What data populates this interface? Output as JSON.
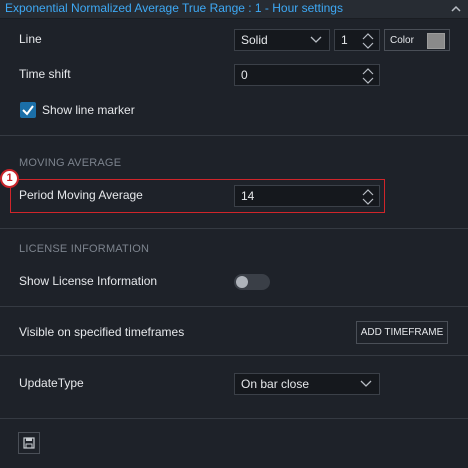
{
  "window": {
    "title": "Exponential Normalized Average True Range : 1 - Hour settings"
  },
  "line": {
    "label": "Line",
    "style_value": "Solid",
    "width_value": "1",
    "color_button_label": "Color",
    "color_swatch": "#8a8a8a"
  },
  "time_shift": {
    "label": "Time shift",
    "value": "0"
  },
  "show_line_marker": {
    "label": "Show line marker",
    "checked": true
  },
  "moving_average": {
    "section_title": "MOVING AVERAGE",
    "period_label": "Period Moving Average",
    "period_value": "14",
    "callout_number": "1"
  },
  "license": {
    "section_title": "LICENSE INFORMATION",
    "show_label": "Show License Information",
    "enabled": false
  },
  "timeframes": {
    "label": "Visible on specified timeframes",
    "button_label": "ADD TIMEFRAME"
  },
  "update_type": {
    "label": "UpdateType",
    "value": "On bar close"
  },
  "footer": {
    "save_icon": "save-icon"
  },
  "colors": {
    "accent": "#3ea9f5",
    "checkbox": "#1b6fa8",
    "highlight": "#d0252a"
  }
}
